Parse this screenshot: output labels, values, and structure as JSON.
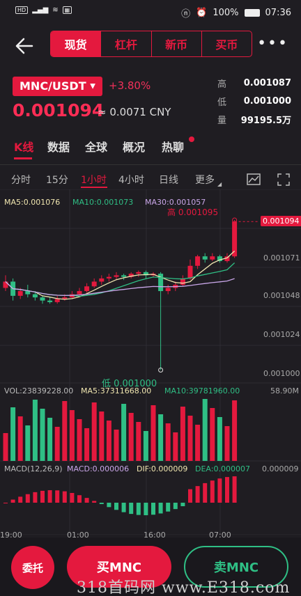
{
  "status": {
    "left": "HD 4G",
    "battery": "100%",
    "time": "07:36"
  },
  "header": {
    "tabs": [
      "现货",
      "杠杆",
      "新币",
      "买币"
    ],
    "active_tab": 0,
    "more": "•••"
  },
  "ticker": {
    "pair": "MNC/USDT",
    "change": "+3.80%",
    "price": "0.001094",
    "cny": "≈ 0.0071 CNY",
    "high_label": "高",
    "high": "0.001087",
    "low_label": "低",
    "low": "0.001000",
    "vol_label": "量",
    "vol": "99195.5万"
  },
  "subtabs": [
    "K线",
    "数据",
    "全球",
    "概况",
    "热聊"
  ],
  "intervals": [
    "分时",
    "15分",
    "1小时",
    "4小时",
    "日线",
    "更多"
  ],
  "indicators": {
    "ma5": "MA5:0.001076",
    "ma10": "MA10:0.001073",
    "ma30": "MA30:0.001057",
    "high_mark": "高 0.001095",
    "low_mark": "低 0.001000",
    "current_price_tag": "0.001094",
    "y_ticks": [
      "0.001071",
      "0.001048",
      "0.001024",
      "0.001000"
    ],
    "vol": "VOL:23839228.00",
    "vol_ma5": "MA5:37311668.00",
    "vol_ma10": "MA10:39781960.00",
    "vol_axis": "58.90M",
    "macd_title": "MACD(12,26,9)",
    "macd": "MACD:0.000006",
    "dif": "DIF:0.000009",
    "dea": "DEA:0.000007",
    "macd_axis": "0.000009",
    "x_ticks": [
      "19:00",
      "01:00",
      "16:00",
      "07:00"
    ]
  },
  "colors": {
    "up": "#e4193e",
    "down": "#2fbf85",
    "ma5": "#f0e6b0",
    "ma10": "#2fbf85",
    "ma30": "#c9a6e8"
  },
  "actions": {
    "entrust": "委托",
    "buy": "买MNC",
    "sell": "卖MNC"
  },
  "watermark": "318首码网 www.E318.com"
}
